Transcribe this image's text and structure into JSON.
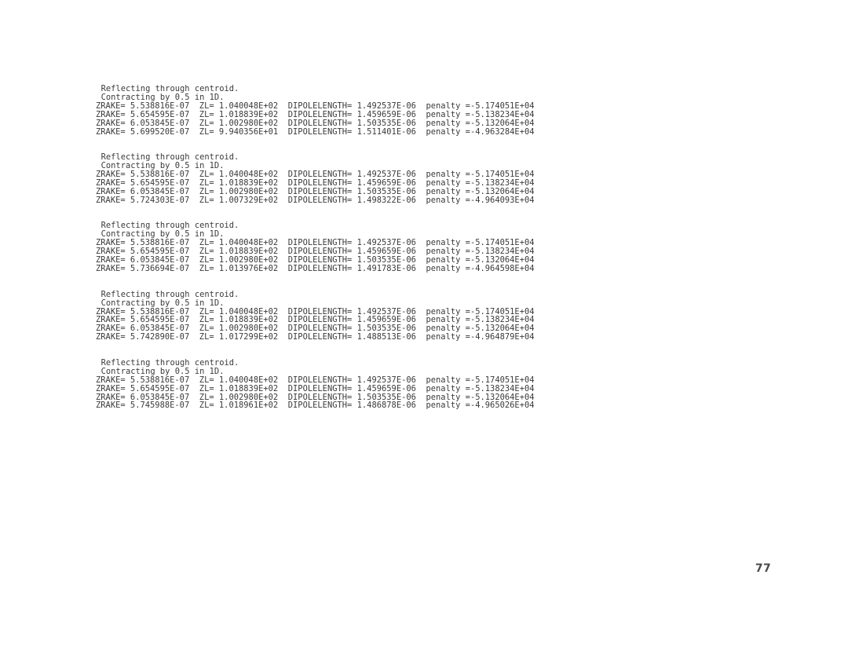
{
  "page": {
    "page_number": "77",
    "background_color": "#ffffff",
    "text_color": "#3a3a3a"
  },
  "log": {
    "blocks": [
      {
        "status_lines": [
          "Reflecting through centroid.",
          "Contracting by 0.5 in 1D."
        ],
        "data_lines": [
          "ZRAKE= 5.538816E-07  ZL= 1.040048E+02  DIPOLELENGTH= 1.492537E-06  penalty =-5.174051E+04",
          "ZRAKE= 5.654595E-07  ZL= 1.018839E+02  DIPOLELENGTH= 1.459659E-06  penalty =-5.138234E+04",
          "ZRAKE= 6.053845E-07  ZL= 1.002980E+02  DIPOLELENGTH= 1.503535E-06  penalty =-5.132064E+04",
          "ZRAKE= 5.699520E-07  ZL= 9.940356E+01  DIPOLELENGTH= 1.511401E-06  penalty =-4.963284E+04"
        ]
      },
      {
        "status_lines": [
          "Reflecting through centroid.",
          "Contracting by 0.5 in 1D."
        ],
        "data_lines": [
          "ZRAKE= 5.538816E-07  ZL= 1.040048E+02  DIPOLELENGTH= 1.492537E-06  penalty =-5.174051E+04",
          "ZRAKE= 5.654595E-07  ZL= 1.018839E+02  DIPOLELENGTH= 1.459659E-06  penalty =-5.138234E+04",
          "ZRAKE= 6.053845E-07  ZL= 1.002980E+02  DIPOLELENGTH= 1.503535E-06  penalty =-5.132064E+04",
          "ZRAKE= 5.724303E-07  ZL= 1.007329E+02  DIPOLELENGTH= 1.498322E-06  penalty =-4.964093E+04"
        ]
      },
      {
        "status_lines": [
          "Reflecting through centroid.",
          "Contracting by 0.5 in 1D."
        ],
        "data_lines": [
          "ZRAKE= 5.538816E-07  ZL= 1.040048E+02  DIPOLELENGTH= 1.492537E-06  penalty =-5.174051E+04",
          "ZRAKE= 5.654595E-07  ZL= 1.018839E+02  DIPOLELENGTH= 1.459659E-06  penalty =-5.138234E+04",
          "ZRAKE= 6.053845E-07  ZL= 1.002980E+02  DIPOLELENGTH= 1.503535E-06  penalty =-5.132064E+04",
          "ZRAKE= 5.736694E-07  ZL= 1.013976E+02  DIPOLELENGTH= 1.491783E-06  penalty =-4.964598E+04"
        ]
      },
      {
        "status_lines": [
          "Reflecting through centroid.",
          "Contracting by 0.5 in 1D."
        ],
        "data_lines": [
          "ZRAKE= 5.538816E-07  ZL= 1.040048E+02  DIPOLELENGTH= 1.492537E-06  penalty =-5.174051E+04",
          "ZRAKE= 5.654595E-07  ZL= 1.018839E+02  DIPOLELENGTH= 1.459659E-06  penalty =-5.138234E+04",
          "ZRAKE= 6.053845E-07  ZL= 1.002980E+02  DIPOLELENGTH= 1.503535E-06  penalty =-5.132064E+04",
          "ZRAKE= 5.742890E-07  ZL= 1.017299E+02  DIPOLELENGTH= 1.488513E-06  penalty =-4.964879E+04"
        ]
      },
      {
        "status_lines": [
          "Reflecting through centroid.",
          "Contracting by 0.5 in 1D."
        ],
        "data_lines": [
          "ZRAKE= 5.538816E-07  ZL= 1.040048E+02  DIPOLELENGTH= 1.492537E-06  penalty =-5.174051E+04",
          "ZRAKE= 5.654595E-07  ZL= 1.018839E+02  DIPOLELENGTH= 1.459659E-06  penalty =-5.138234E+04",
          "ZRAKE= 6.053845E-07  ZL= 1.002980E+02  DIPOLELENGTH= 1.503535E-06  penalty =-5.132064E+04",
          "ZRAKE= 5.745988E-07  ZL= 1.018961E+02  DIPOLELENGTH= 1.486878E-06  penalty =-4.965026E+04"
        ]
      }
    ]
  }
}
